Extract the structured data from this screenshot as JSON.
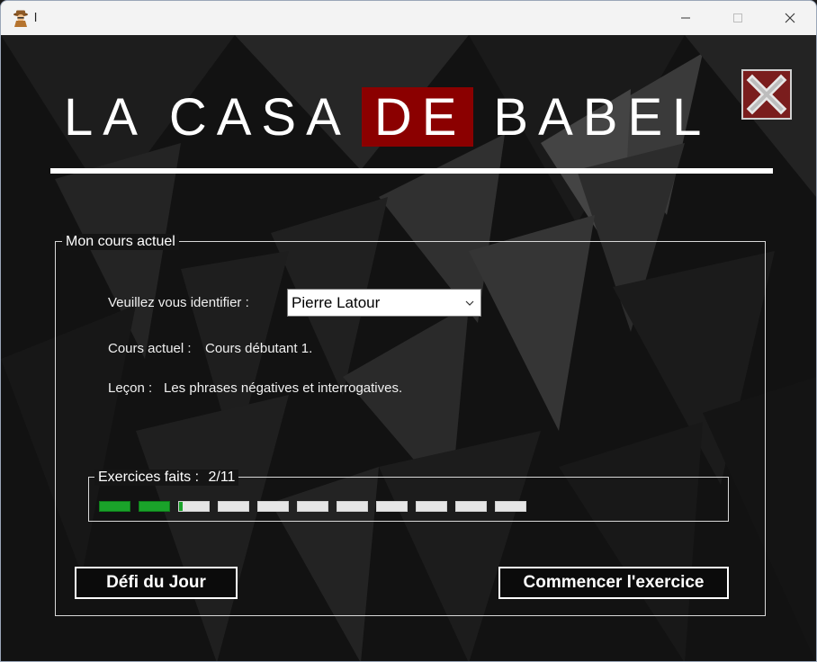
{
  "window": {
    "title": "l",
    "icons": {
      "app": "detective-icon",
      "minimize": "minimize-icon",
      "maximize": "maximize-icon",
      "close": "close-icon"
    }
  },
  "header": {
    "logo_part1": "LA CASA",
    "logo_part2": "DE",
    "logo_part3": "BABEL",
    "close_icon": "close-x-icon"
  },
  "course_group": {
    "legend": "Mon cours actuel",
    "identify_label": "Veuillez vous identifier :",
    "user_select_value": "Pierre Latour",
    "current_course_label": "Cours actuel :",
    "current_course_value": "Cours débutant 1.",
    "lesson_label": "Leçon :",
    "lesson_value": "Les phrases négatives et interrogatives."
  },
  "progress": {
    "label": "Exercices faits :",
    "value_text": "2/11",
    "done": 2,
    "total": 11
  },
  "buttons": {
    "daily_challenge": "Défi du Jour",
    "start_exercise": "Commencer l'exercice"
  },
  "colors": {
    "accent_red": "#8b0000",
    "progress_green": "#1aa32a",
    "background": "#101010"
  }
}
